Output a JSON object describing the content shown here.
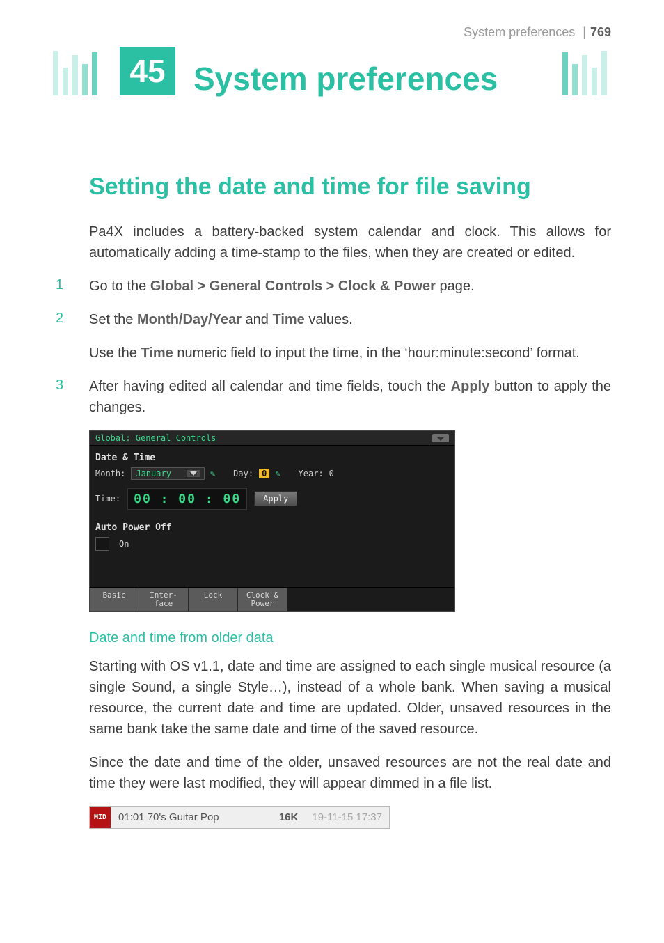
{
  "running_head": {
    "title": "System preferences",
    "page_num": "769"
  },
  "chapter": {
    "number": "45",
    "title": "System preferences"
  },
  "section_heading": "Setting the date and time for file saving",
  "intro": "Pa4X includes a battery-backed system calendar and clock. This allows for automatically adding a time-stamp to the files, when they are created or edited.",
  "steps": {
    "s1_a": "Go to the ",
    "s1_term": "Global > General Controls > Clock & Power",
    "s1_b": " page.",
    "s2_a": "Set the ",
    "s2_term1": "Month/Day/Year",
    "s2_mid": " and ",
    "s2_term2": "Time",
    "s2_b": " values.",
    "s2_note_a": "Use the ",
    "s2_note_term": "Time",
    "s2_note_b": " numeric field to input the time, in the ‘hour:minute:second’ format.",
    "s3_a": "After having edited all calendar and time fields, touch the ",
    "s3_term": "Apply",
    "s3_b": " button to apply the changes."
  },
  "device": {
    "title": "Global: General Controls",
    "group_datetime": "Date & Time",
    "month_label": "Month:",
    "month_value": "January",
    "day_label": "Day:",
    "day_value": "0",
    "year_label": "Year:",
    "year_value": "0",
    "time_label": "Time:",
    "time_value": "00 : 00 : 00",
    "apply_label": "Apply",
    "group_power": "Auto Power Off",
    "power_checkbox_label": "On",
    "tabs": [
      "Basic",
      "Inter-\nface",
      "Lock",
      "Clock &\nPower"
    ]
  },
  "subheading": "Date and time from older data",
  "para1": "Starting with OS v1.1, date and time are assigned to each single musical resource (a single Sound, a single Style…), instead of a whole bank. When saving a musical resource, the current date and time are updated. Older, unsaved resources in the same bank take the same date and time of the saved resource.",
  "para2": "Since the date and time of the older, unsaved resources are not the real date and time they were last modified, they will appear dimmed in a file list.",
  "filerow": {
    "icon_text": "MID",
    "name": "01:01 70's Guitar Pop",
    "size": "16K",
    "date": "19-11-15 17:37"
  }
}
